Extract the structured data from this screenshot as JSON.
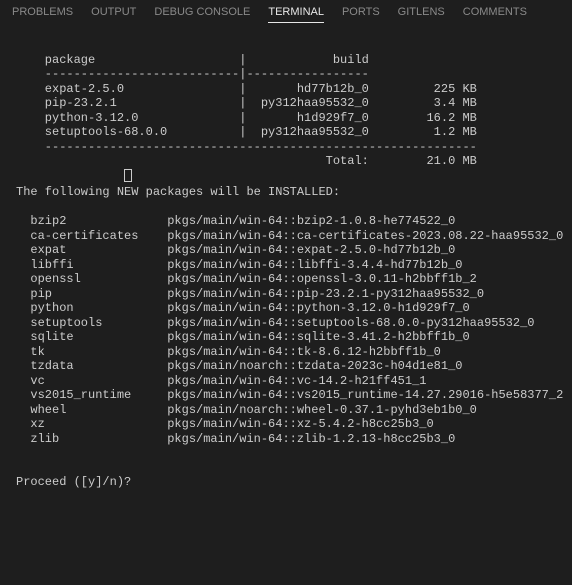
{
  "tabs": [
    {
      "label": "PROBLEMS",
      "active": false
    },
    {
      "label": "OUTPUT",
      "active": false
    },
    {
      "label": "DEBUG CONSOLE",
      "active": false
    },
    {
      "label": "TERMINAL",
      "active": true
    },
    {
      "label": "PORTS",
      "active": false
    },
    {
      "label": "GITLENS",
      "active": false
    },
    {
      "label": "COMMENTS",
      "active": false
    }
  ],
  "table": {
    "blank_top": " ",
    "header_line": "    package                    |            build",
    "divider": "    ---------------------------|-----------------",
    "rows": [
      "    expat-2.5.0                |       hd77b12b_0         225 KB",
      "    pip-23.2.1                 |  py312haa95532_0         3.4 MB",
      "    python-3.12.0              |       h1d929f7_0        16.2 MB",
      "    setuptools-68.0.0          |  py312haa95532_0         1.2 MB"
    ],
    "divider_closed": "    ------------------------------------------------------------",
    "total_line": "                                           Total:        21.0 MB"
  },
  "install_heading": "The following NEW packages will be INSTALLED:",
  "install_rows": [
    "  bzip2              pkgs/main/win-64::bzip2-1.0.8-he774522_0",
    "  ca-certificates    pkgs/main/win-64::ca-certificates-2023.08.22-haa95532_0",
    "  expat              pkgs/main/win-64::expat-2.5.0-hd77b12b_0",
    "  libffi             pkgs/main/win-64::libffi-3.4.4-hd77b12b_0",
    "  openssl            pkgs/main/win-64::openssl-3.0.11-h2bbff1b_2",
    "  pip                pkgs/main/win-64::pip-23.2.1-py312haa95532_0",
    "  python             pkgs/main/win-64::python-3.12.0-h1d929f7_0",
    "  setuptools         pkgs/main/win-64::setuptools-68.0.0-py312haa95532_0",
    "  sqlite             pkgs/main/win-64::sqlite-3.41.2-h2bbff1b_0",
    "  tk                 pkgs/main/win-64::tk-8.6.12-h2bbff1b_0",
    "  tzdata             pkgs/main/noarch::tzdata-2023c-h04d1e81_0",
    "  vc                 pkgs/main/win-64::vc-14.2-h21ff451_1",
    "  vs2015_runtime     pkgs/main/win-64::vs2015_runtime-14.27.29016-h5e58377_2",
    "  wheel              pkgs/main/noarch::wheel-0.37.1-pyhd3eb1b0_0",
    "  xz                 pkgs/main/win-64::xz-5.4.2-h8cc25b3_0",
    "  zlib               pkgs/main/win-64::zlib-1.2.13-h8cc25b3_0"
  ],
  "prompt": "Proceed ([y]/n)? "
}
